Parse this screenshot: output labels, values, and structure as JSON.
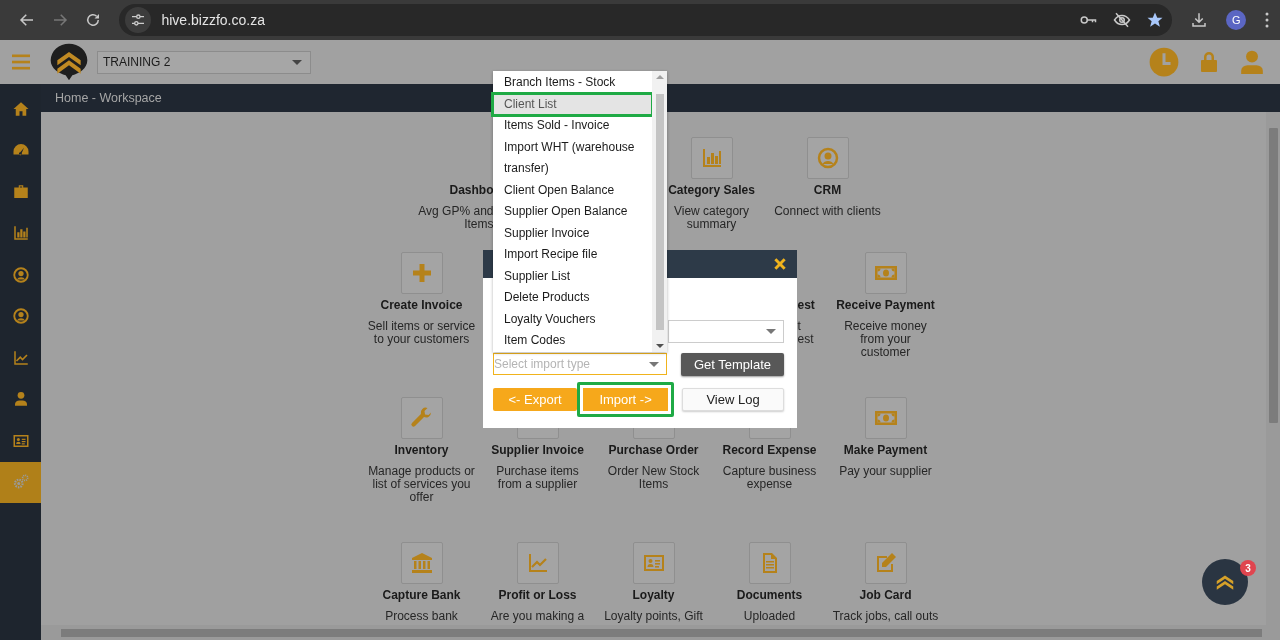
{
  "browser": {
    "url": "hive.bizzfo.co.za",
    "profile": "G"
  },
  "header": {
    "company": "TRAINING 2"
  },
  "sidebar": {
    "items": [
      {
        "selected": false
      },
      {
        "selected": false
      },
      {
        "selected": false
      },
      {
        "selected": false
      },
      {
        "selected": false
      },
      {
        "selected": false
      },
      {
        "selected": false
      },
      {
        "selected": false
      },
      {
        "selected": false
      },
      {
        "selected": true
      }
    ]
  },
  "breadcrumb": "Home - Workspace",
  "workspace": {
    "rows": [
      [
        {
          "kind": "cut-right",
          "title": "Dashbo",
          "description": "Avg GP% and\nItems"
        },
        {
          "kind": "hidden"
        },
        {
          "kind": "tile",
          "title": "Category Sales",
          "description": "View category\nsummary"
        },
        {
          "kind": "tile",
          "title": "CRM",
          "description": "Connect with clients"
        }
      ],
      [
        {
          "kind": "tile",
          "title": "Create Invoice",
          "description": "Sell items or service\nto your customers"
        },
        {
          "kind": "hidden"
        },
        {
          "kind": "hidden"
        },
        {
          "kind": "cut-left",
          "title": "est",
          "description": "t\nest"
        },
        {
          "kind": "tile",
          "title": "Receive Payment",
          "description": "Receive money\nfrom your\ncustomer"
        }
      ],
      [
        {
          "kind": "tile",
          "title": "Inventory",
          "description": "Manage products or\nlist of services you\noffer"
        },
        {
          "kind": "tile",
          "title": "Supplier Invoice",
          "description": "Purchase items\nfrom a supplier"
        },
        {
          "kind": "tile",
          "title": "Purchase Order",
          "description": "Order New Stock\nItems"
        },
        {
          "kind": "tile",
          "title": "Record Expense",
          "description": "Capture business\nexpense"
        },
        {
          "kind": "tile",
          "title": "Make Payment",
          "description": "Pay your supplier"
        }
      ],
      [
        {
          "kind": "tile",
          "title": "Capture Bank",
          "description": "Process bank"
        },
        {
          "kind": "tile",
          "title": "Profit or Loss",
          "description": "Are you making a"
        },
        {
          "kind": "tile",
          "title": "Loyalty",
          "description": "Loyalty points, Gift"
        },
        {
          "kind": "tile",
          "title": "Documents",
          "description": "Uploaded"
        },
        {
          "kind": "tile",
          "title": "Job Card",
          "description": "Track jobs, call outs"
        }
      ]
    ]
  },
  "import_dialog": {
    "import_type": {
      "placeholder": "Select import type"
    },
    "get_template": "Get Template",
    "export": "<- Export",
    "import": {
      "label": "Import ->",
      "highlighted": true
    },
    "view_log": "View Log"
  },
  "import_type_list": {
    "items": [
      {
        "label": "Branch Items - Stock",
        "selected": false,
        "highlighted": false
      },
      {
        "label": "Client List",
        "selected": true,
        "highlighted": true
      },
      {
        "label": "Items Sold - Invoice",
        "selected": false,
        "highlighted": false
      },
      {
        "label": "Import WHT (warehouse transfer)",
        "selected": false,
        "highlighted": false
      },
      {
        "label": "Client Open Balance",
        "selected": false,
        "highlighted": false
      },
      {
        "label": "Supplier Open Balance",
        "selected": false,
        "highlighted": false
      },
      {
        "label": "Supplier Invoice",
        "selected": false,
        "highlighted": false
      },
      {
        "label": "Import Recipe file",
        "selected": false,
        "highlighted": false
      },
      {
        "label": "Supplier List",
        "selected": false,
        "highlighted": false
      },
      {
        "label": "Delete Products",
        "selected": false,
        "highlighted": false
      },
      {
        "label": "Loyalty Vouchers",
        "selected": false,
        "highlighted": false
      },
      {
        "label": "Item Codes",
        "selected": false,
        "highlighted": false
      }
    ]
  },
  "chat": {
    "badge": "3"
  }
}
